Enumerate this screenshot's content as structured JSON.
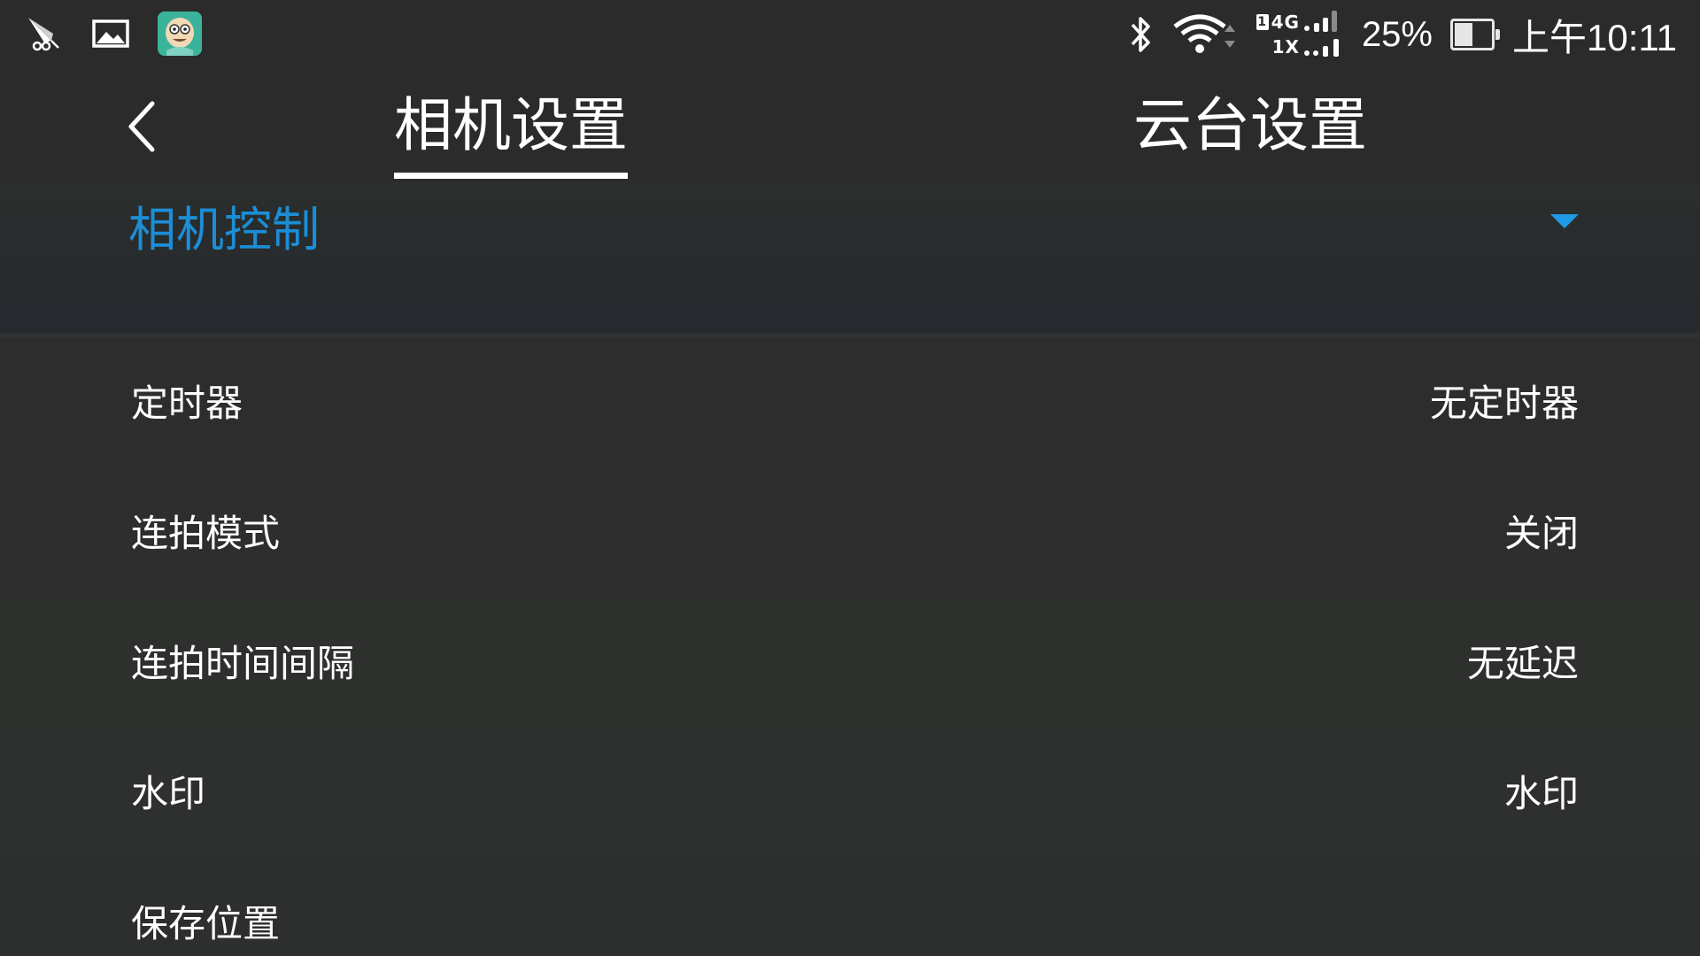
{
  "status_bar": {
    "left_icons": [
      "kite-icon",
      "image-icon",
      "app-avatar-icon"
    ],
    "network_sim": "1",
    "network_row1": "4G",
    "network_row2": "1X",
    "battery_percent_text": "25%",
    "battery_level": 0.25,
    "time": "上午10:11"
  },
  "tabs": [
    {
      "label": "相机设置",
      "active": true
    },
    {
      "label": "云台设置",
      "active": false
    }
  ],
  "section": {
    "title": "相机控制",
    "expanded": true
  },
  "settings": [
    {
      "label": "定时器",
      "value": "无定时器"
    },
    {
      "label": "连拍模式",
      "value": "关闭"
    },
    {
      "label": "连拍时间间隔",
      "value": "无延迟"
    },
    {
      "label": "水印",
      "value": "水印"
    },
    {
      "label": "保存位置",
      "value": ""
    }
  ],
  "colors": {
    "background": "#2d2d2d",
    "accent": "#1c8ed6",
    "text": "#ffffff"
  }
}
